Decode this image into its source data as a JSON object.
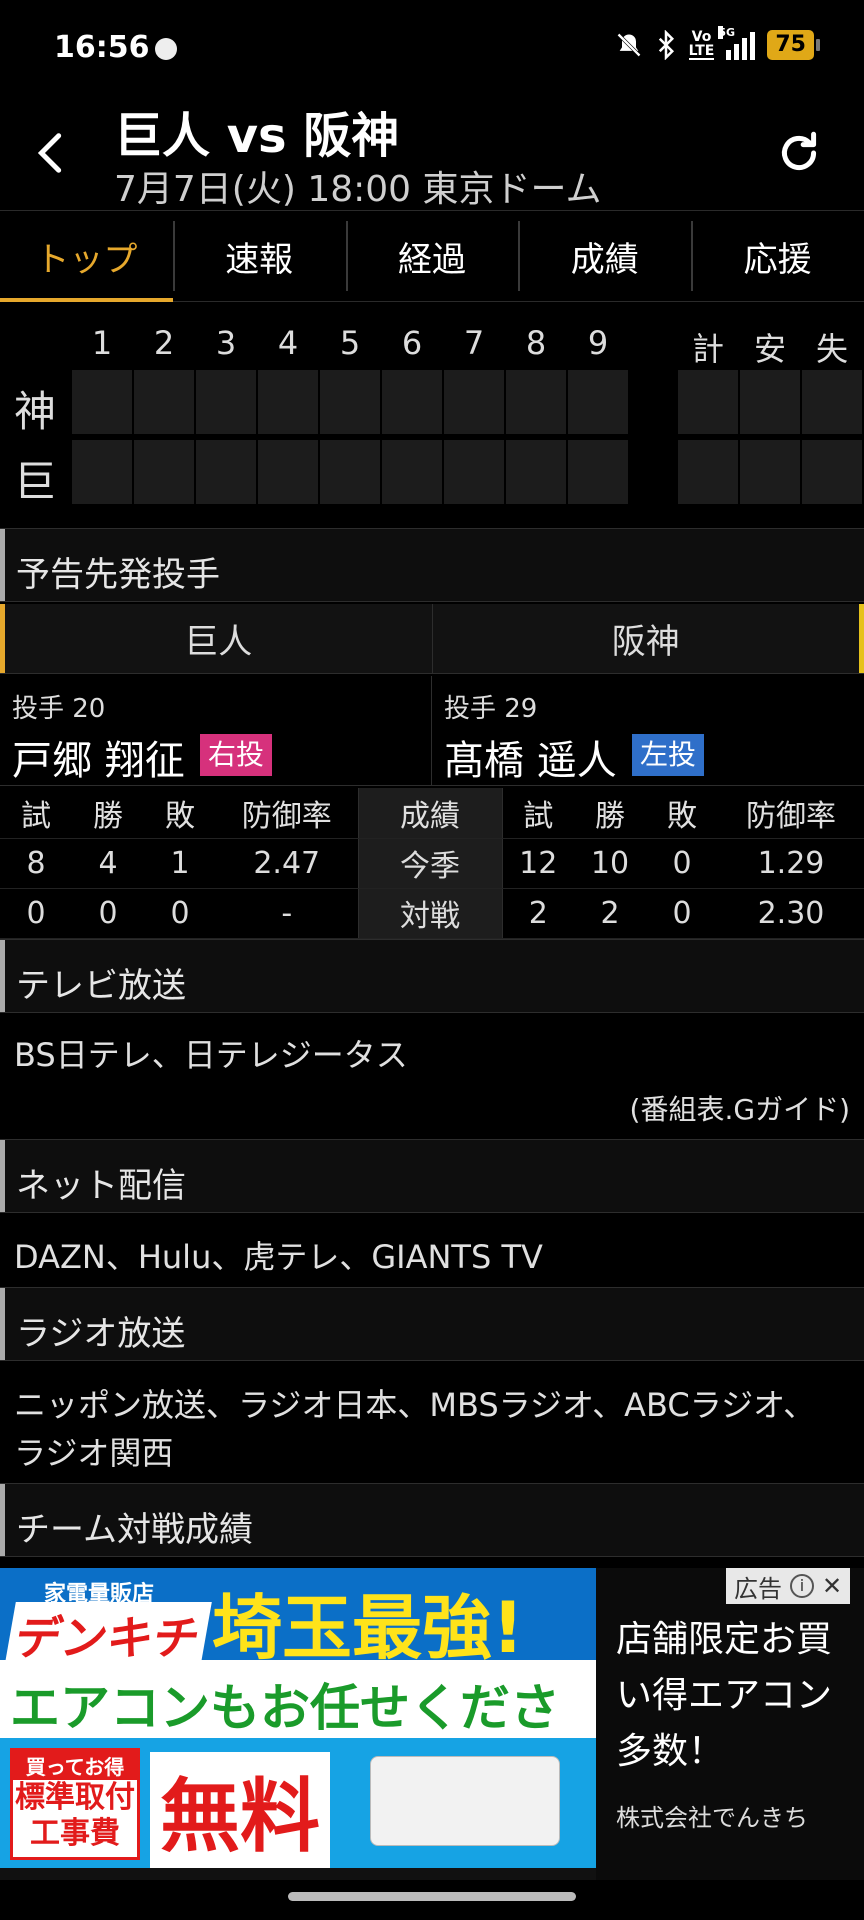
{
  "status_bar": {
    "time": "16:56",
    "volte": "Vo\nLTE",
    "network": "5G",
    "battery": "75"
  },
  "header": {
    "title": "巨人 vs 阪神",
    "subtitle": "7月7日(火) 18:00 東京ドーム"
  },
  "tabs": [
    "トップ",
    "速報",
    "経過",
    "成績",
    "応援"
  ],
  "scoreboard": {
    "innings": [
      "1",
      "2",
      "3",
      "4",
      "5",
      "6",
      "7",
      "8",
      "9"
    ],
    "totals_headers": [
      "計",
      "安",
      "失"
    ],
    "teams": [
      "神",
      "巨"
    ]
  },
  "starting_pitchers": {
    "section_title": "予告先発投手",
    "home_team": "巨人",
    "away_team": "阪神",
    "home_pitcher": {
      "number": "投手 20",
      "name": "戸郷 翔征",
      "hand": "右投"
    },
    "away_pitcher": {
      "number": "投手 29",
      "name": "髙橋 遥人",
      "hand": "左投"
    },
    "stats_headers": [
      "試",
      "勝",
      "敗",
      "防御率",
      "成績",
      "試",
      "勝",
      "敗",
      "防御率"
    ],
    "stats_rows": [
      [
        "8",
        "4",
        "1",
        "2.47",
        "今季",
        "12",
        "10",
        "0",
        "1.29"
      ],
      [
        "0",
        "0",
        "0",
        "-",
        "対戦",
        "2",
        "2",
        "0",
        "2.30"
      ]
    ]
  },
  "tv": {
    "title": "テレビ放送",
    "channels": "BS日テレ、日テレジータス",
    "source": "(番組表.Gガイド)"
  },
  "net": {
    "title": "ネット配信",
    "services": "DAZN、Hulu、虎テレ、GIANTS TV"
  },
  "radio": {
    "title": "ラジオ放送",
    "line1": "ニッポン放送、ラジオ日本、MBSラジオ、ABCラジオ、",
    "line2": "ラジオ関西"
  },
  "team_record": {
    "title": "チーム対戦成績"
  },
  "ad": {
    "label": "広告",
    "store_type": "家電量販店",
    "brand": "デンキチ",
    "headline": "埼玉最強!",
    "aircon": "エアコンもお任せください!",
    "box_top": "買ってお得",
    "box_text": "標準取付工事費",
    "free": "無料",
    "text": "店舗限定お買い得エアコン多数！",
    "company": "株式会社でんきち"
  }
}
